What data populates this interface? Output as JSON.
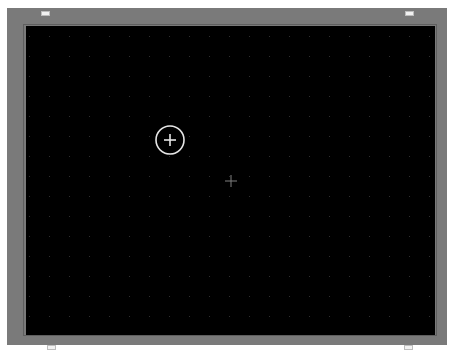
{
  "canvas": {
    "background_color": "#000000",
    "frame_color": "#7a7a7a",
    "grid_dot_color": "#2f2f2f",
    "grid": true
  },
  "cursor": {
    "icon": "crosshair-circle-icon",
    "color": "#e6e6e6"
  },
  "center_marker": {
    "icon": "plus-icon",
    "color": "#7f7f7f"
  },
  "handles": {
    "icon": "resize-handle-icon",
    "color": "#f2f2f2"
  }
}
